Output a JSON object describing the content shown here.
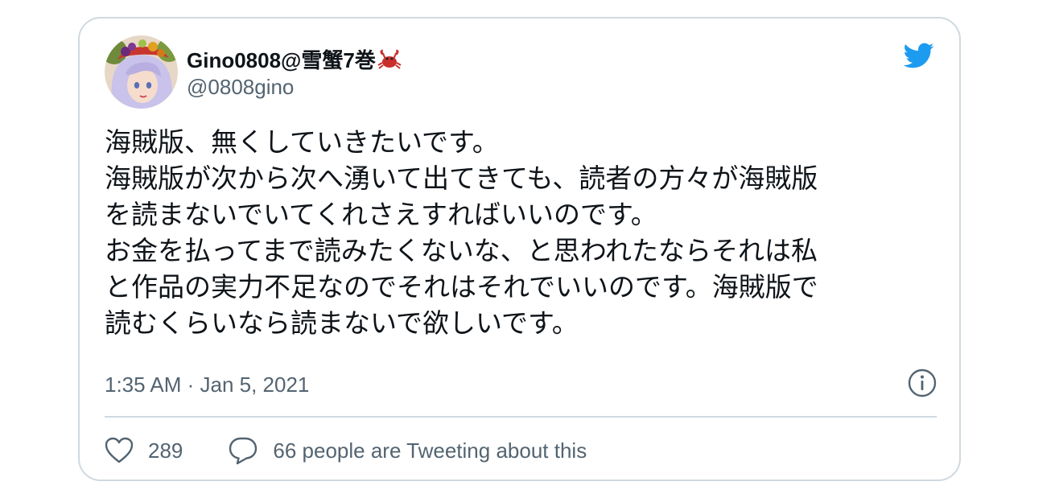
{
  "tweet": {
    "display_name": "Gino0808@雪蟹7巻",
    "name_emoji": "🦀",
    "handle": "@0808gino",
    "text_lines": [
      "海賊版、無くしていきたいです。",
      "海賊版が次から次へ湧いて出てきても、読者の方々が海賊版",
      "を読まないでいてくれさえすればいいのです。",
      "お金を払ってまで読みたくないな、と思われたならそれは私",
      "と作品の実力不足なのでそれはそれでいいのです。海賊版で",
      "読むくらいなら読まないで欲しいです。"
    ],
    "timestamp": "1:35 AM · Jan 5, 2021",
    "likes": "289",
    "tweeting_about": "66 people are Tweeting about this"
  },
  "icons": {
    "brand": "twitter-bird-icon",
    "info": "info-icon",
    "like": "heart-icon",
    "reply": "speech-bubble-icon"
  },
  "colors": {
    "brand_blue": "#1d9bf0",
    "text": "#0f1419",
    "secondary": "#536471",
    "border": "#cfd9de"
  }
}
